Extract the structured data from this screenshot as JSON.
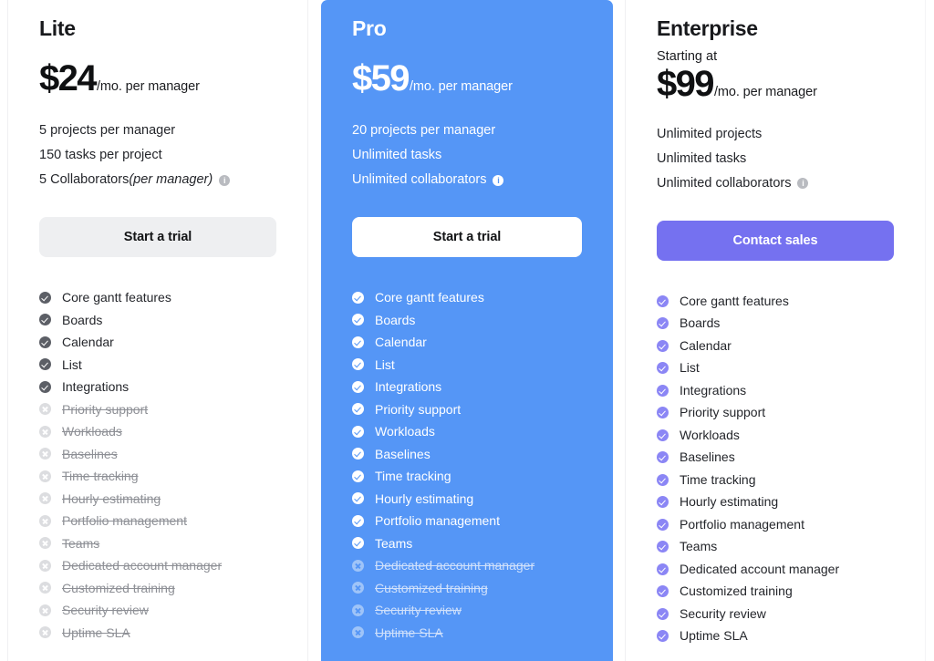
{
  "theme": {
    "pro_bg": "#5596f6",
    "purple_cta": "#7571f0",
    "gray_cta": "#eeeff1",
    "check_dark": "#5c5f66",
    "check_purple": "#8b86f5",
    "disabled_gray": "#dcdde0"
  },
  "plans": [
    {
      "name": "Lite",
      "starting_at": "",
      "price": "$24",
      "price_suffix": "/mo. per manager",
      "cta_label": "Start a trial",
      "cta_style": "gray",
      "quotas": [
        {
          "text": "5 projects per manager",
          "note": "",
          "info": false
        },
        {
          "text": "150 tasks per project",
          "note": "",
          "info": false
        },
        {
          "text": "5 Collaborators",
          "note": "(per manager)",
          "info": true,
          "info_icon": "info-icon"
        }
      ],
      "features": [
        {
          "label": "Core gantt features",
          "enabled": true
        },
        {
          "label": "Boards",
          "enabled": true
        },
        {
          "label": "Calendar",
          "enabled": true
        },
        {
          "label": "List",
          "enabled": true
        },
        {
          "label": "Integrations",
          "enabled": true
        },
        {
          "label": "Priority support",
          "enabled": false
        },
        {
          "label": "Workloads",
          "enabled": false
        },
        {
          "label": "Baselines",
          "enabled": false
        },
        {
          "label": "Time tracking",
          "enabled": false
        },
        {
          "label": "Hourly estimating",
          "enabled": false
        },
        {
          "label": "Portfolio management",
          "enabled": false
        },
        {
          "label": "Teams",
          "enabled": false
        },
        {
          "label": "Dedicated account manager",
          "enabled": false
        },
        {
          "label": "Customized training",
          "enabled": false
        },
        {
          "label": "Security review",
          "enabled": false
        },
        {
          "label": "Uptime SLA",
          "enabled": false
        }
      ]
    },
    {
      "name": "Pro",
      "starting_at": "",
      "price": "$59",
      "price_suffix": "/mo. per manager",
      "cta_label": "Start a trial",
      "cta_style": "white",
      "quotas": [
        {
          "text": "20 projects per manager",
          "note": "",
          "info": false
        },
        {
          "text": "Unlimited tasks",
          "note": "",
          "info": false
        },
        {
          "text": "Unlimited collaborators",
          "note": "",
          "info": true,
          "info_icon": "info-icon"
        }
      ],
      "features": [
        {
          "label": "Core gantt features",
          "enabled": true
        },
        {
          "label": "Boards",
          "enabled": true
        },
        {
          "label": "Calendar",
          "enabled": true
        },
        {
          "label": "List",
          "enabled": true
        },
        {
          "label": "Integrations",
          "enabled": true
        },
        {
          "label": "Priority support",
          "enabled": true
        },
        {
          "label": "Workloads",
          "enabled": true
        },
        {
          "label": "Baselines",
          "enabled": true
        },
        {
          "label": "Time tracking",
          "enabled": true
        },
        {
          "label": "Hourly estimating",
          "enabled": true
        },
        {
          "label": "Portfolio management",
          "enabled": true
        },
        {
          "label": "Teams",
          "enabled": true
        },
        {
          "label": "Dedicated account manager",
          "enabled": false
        },
        {
          "label": "Customized training",
          "enabled": false
        },
        {
          "label": "Security review",
          "enabled": false
        },
        {
          "label": "Uptime SLA",
          "enabled": false
        }
      ]
    },
    {
      "name": "Enterprise",
      "starting_at": "Starting at",
      "price": "$99",
      "price_suffix": "/mo. per manager",
      "cta_label": "Contact sales",
      "cta_style": "purple",
      "quotas": [
        {
          "text": "Unlimited projects",
          "note": "",
          "info": false
        },
        {
          "text": "Unlimited tasks",
          "note": "",
          "info": false
        },
        {
          "text": "Unlimited collaborators",
          "note": "",
          "info": true,
          "info_icon": "info-icon"
        }
      ],
      "features": [
        {
          "label": "Core gantt features",
          "enabled": true
        },
        {
          "label": "Boards",
          "enabled": true
        },
        {
          "label": "Calendar",
          "enabled": true
        },
        {
          "label": "List",
          "enabled": true
        },
        {
          "label": "Integrations",
          "enabled": true
        },
        {
          "label": "Priority support",
          "enabled": true
        },
        {
          "label": "Workloads",
          "enabled": true
        },
        {
          "label": "Baselines",
          "enabled": true
        },
        {
          "label": "Time tracking",
          "enabled": true
        },
        {
          "label": "Hourly estimating",
          "enabled": true
        },
        {
          "label": "Portfolio management",
          "enabled": true
        },
        {
          "label": "Teams",
          "enabled": true
        },
        {
          "label": "Dedicated account manager",
          "enabled": true
        },
        {
          "label": "Customized training",
          "enabled": true
        },
        {
          "label": "Security review",
          "enabled": true
        },
        {
          "label": "Uptime SLA",
          "enabled": true
        }
      ]
    }
  ]
}
